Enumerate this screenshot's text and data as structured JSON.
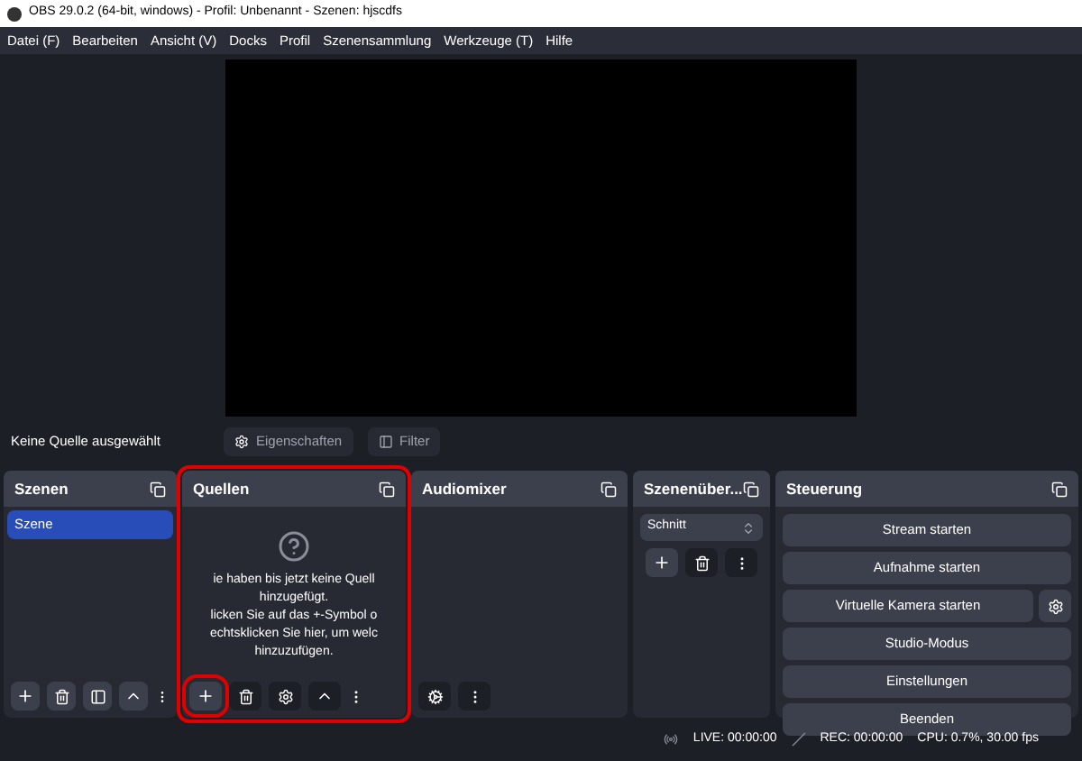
{
  "window": {
    "title": "OBS 29.0.2 (64-bit, windows) - Profil: Unbenannt - Szenen: hjscdfs"
  },
  "menu": [
    "Datei (F)",
    "Bearbeiten",
    "Ansicht (V)",
    "Docks",
    "Profil",
    "Szenensammlung",
    "Werkzeuge (T)",
    "Hilfe"
  ],
  "source_bar": {
    "label": "Keine Quelle ausgewählt",
    "buttons": [
      {
        "label": "Eigenschaften",
        "kind": "gear"
      },
      {
        "label": "Filter",
        "kind": "filter"
      }
    ]
  },
  "scenes": {
    "title": "Szenen",
    "items": [
      {
        "label": "Szene",
        "selected": true
      }
    ]
  },
  "sources": {
    "title": "Quellen",
    "empty_message": [
      "ie haben bis jetzt keine Quell",
      "hinzugefügt.",
      "licken Sie auf das +-Symbol o",
      "echtsklicken Sie hier, um welc",
      "hinzuzufügen."
    ]
  },
  "audiomixer": {
    "title": "Audiomixer"
  },
  "transitions": {
    "title": "Szenenüber...",
    "select_value": "Schnitt"
  },
  "controls": {
    "title": "Steuerung",
    "buttons": [
      {
        "label": "Stream starten",
        "kind": "plain"
      },
      {
        "label": "Aufnahme starten",
        "kind": "plain"
      },
      {
        "label": "Virtuelle Kamera starten",
        "kind": "with_settings"
      },
      {
        "label": "Studio-Modus",
        "kind": "plain"
      },
      {
        "label": "Einstellungen",
        "kind": "plain"
      },
      {
        "label": "Beenden",
        "kind": "plain"
      }
    ]
  },
  "status_bar": {
    "live": "LIVE: 00:00:00",
    "rec": "REC: 00:00:00",
    "cpu": "CPU: 0.7%, 30.00 fps"
  }
}
